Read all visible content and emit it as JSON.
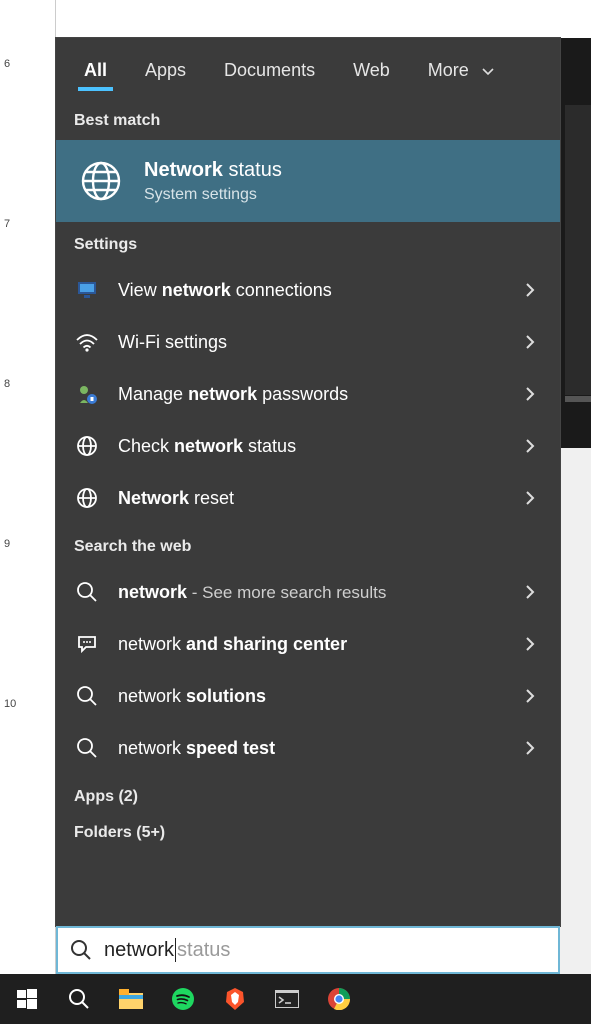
{
  "tabs": {
    "all": "All",
    "apps": "Apps",
    "documents": "Documents",
    "web": "Web",
    "more": "More"
  },
  "sections": {
    "best_match": "Best match",
    "settings": "Settings",
    "search_web": "Search the web",
    "apps_count": "Apps (2)",
    "folders_count": "Folders (5+)"
  },
  "best": {
    "title_bold": "Network",
    "title_rest": " status",
    "subtitle": "System settings"
  },
  "settings_items": [
    {
      "pre": "View ",
      "bold": "network",
      "post": " connections",
      "icon": "network-connections-icon"
    },
    {
      "pre": "Wi-Fi ",
      "bold": "",
      "post": "settings",
      "icon": "wifi-icon"
    },
    {
      "pre": "Manage ",
      "bold": "network",
      "post": " passwords",
      "icon": "manage-passwords-icon"
    },
    {
      "pre": "Check ",
      "bold": "network",
      "post": " status",
      "icon": "globe-icon"
    },
    {
      "pre": "",
      "bold": "Network",
      "post": " reset",
      "icon": "globe-icon"
    }
  ],
  "web_items": [
    {
      "pre": "",
      "bold": "network",
      "post": "",
      "suffix": " - See more search results",
      "icon": "search-icon"
    },
    {
      "pre": "network ",
      "bold": "and sharing center",
      "post": "",
      "suffix": "",
      "icon": "chat-icon"
    },
    {
      "pre": "network ",
      "bold": "solutions",
      "post": "",
      "suffix": "",
      "icon": "search-icon"
    },
    {
      "pre": "network ",
      "bold": "speed test",
      "post": "",
      "suffix": "",
      "icon": "search-icon"
    }
  ],
  "search": {
    "typed": "network",
    "suggestion_suffix": " status"
  },
  "taskbar": {
    "start": "start-icon",
    "search": "search-icon",
    "explorer": "file-explorer-icon",
    "spotify": "spotify-icon",
    "brave": "brave-icon",
    "terminal": "terminal-icon",
    "chrome": "chrome-icon"
  },
  "colors": {
    "accent": "#4cc2ff",
    "best_match_bg": "#3f6f84",
    "panel_bg": "#3b3b3b",
    "search_border": "#6fb7d6"
  }
}
